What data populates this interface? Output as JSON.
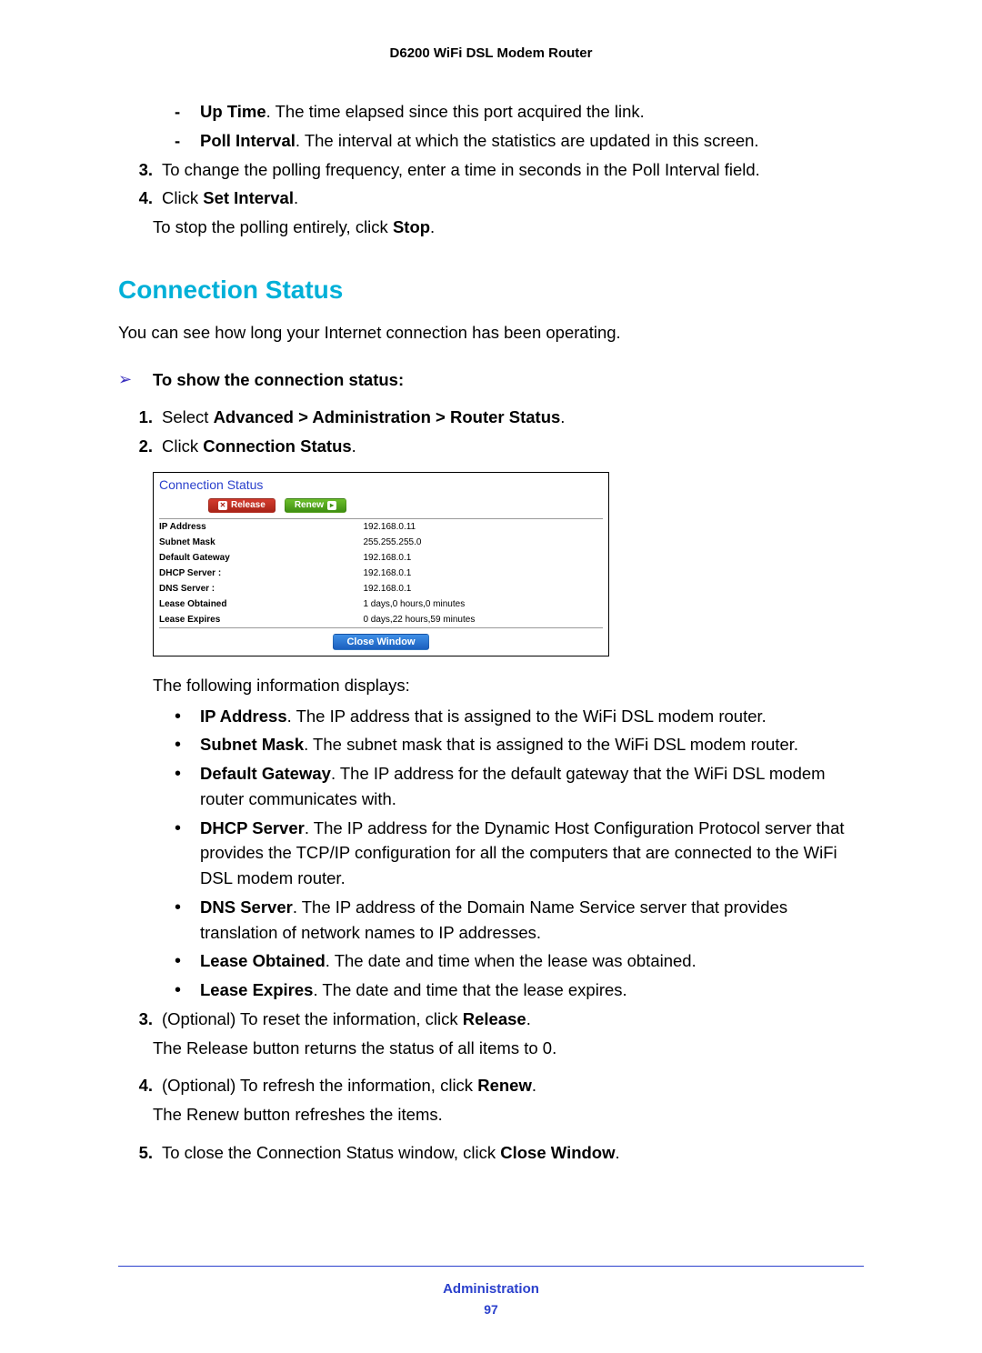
{
  "header": {
    "title": "D6200 WiFi DSL Modem Router"
  },
  "dashlist": [
    {
      "term": "Up Time",
      "desc": ". The time elapsed since this port acquired the link."
    },
    {
      "term": "Poll Interval",
      "desc": ". The interval at which the statistics are updated in this screen."
    }
  ],
  "step3": {
    "num": "3.",
    "text": "To change the polling frequency, enter a time in seconds in the Poll Interval field."
  },
  "step4": {
    "num": "4.",
    "prefix": "Click ",
    "bold": "Set Interval",
    "suffix": ".",
    "follow_pre": "To stop the polling entirely, click ",
    "follow_bold": "Stop",
    "follow_post": "."
  },
  "section_title": "Connection Status",
  "section_intro": "You can see how long your Internet connection has been operating.",
  "howto_title": "To show the connection status:",
  "steps": {
    "s1": {
      "num": "1.",
      "pre": "Select ",
      "bold": "Advanced > Administration > Router Status",
      "post": "."
    },
    "s2": {
      "num": "2.",
      "pre": "Click ",
      "bold": "Connection Status",
      "post": "."
    },
    "s3": {
      "num": "3.",
      "pre": "(Optional) To reset the information, click ",
      "bold": "Release",
      "post": ".",
      "follow": "The Release button returns the status of all items to 0."
    },
    "s4": {
      "num": "4.",
      "pre": "(Optional) To refresh the information, click ",
      "bold": "Renew",
      "post": ".",
      "follow": "The Renew button refreshes the items."
    },
    "s5": {
      "num": "5.",
      "pre": "To close the Connection Status window, click ",
      "bold": "Close Window",
      "post": "."
    }
  },
  "shot": {
    "title": "Connection Status",
    "release": "Release",
    "renew": "Renew",
    "close": "Close Window",
    "rows": [
      {
        "label": "IP Address",
        "value": "192.168.0.11"
      },
      {
        "label": "Subnet Mask",
        "value": "255.255.255.0"
      },
      {
        "label": "Default Gateway",
        "value": "192.168.0.1"
      },
      {
        "label": "DHCP Server :",
        "value": "192.168.0.1"
      },
      {
        "label": "DNS Server :",
        "value": "192.168.0.1"
      },
      {
        "label": "Lease Obtained",
        "value": "1 days,0 hours,0 minutes"
      },
      {
        "label": "Lease Expires",
        "value": "0 days,22 hours,59 minutes"
      }
    ]
  },
  "follow_info_intro": "The following information displays:",
  "bullets": [
    {
      "term": "IP Address",
      "desc": ". The IP address that is assigned to the WiFi DSL modem router."
    },
    {
      "term": "Subnet Mask",
      "desc": ". The subnet mask that is assigned to the WiFi DSL modem router."
    },
    {
      "term": "Default Gateway",
      "desc": ". The IP address for the default gateway that the WiFi DSL modem router communicates with."
    },
    {
      "term": "DHCP Server",
      "desc": ". The IP address for the Dynamic Host Configuration Protocol server that provides the TCP/IP configuration for all the computers that are connected to the WiFi DSL modem router."
    },
    {
      "term": "DNS Server",
      "desc": ". The IP address of the Domain Name Service server that provides translation of network names to IP addresses."
    },
    {
      "term": "Lease Obtained",
      "desc": ". The date and time when the lease was obtained."
    },
    {
      "term": "Lease Expires",
      "desc": ". The date and time that the lease expires."
    }
  ],
  "footer": {
    "label": "Administration",
    "page": "97"
  }
}
